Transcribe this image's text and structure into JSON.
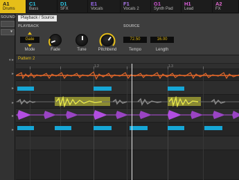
{
  "groups": [
    {
      "id": "A1",
      "name": "Drums",
      "color": "#e6be19",
      "active": true
    },
    {
      "id": "C1",
      "name": "Bass",
      "color": "#2ec7e6",
      "active": false
    },
    {
      "id": "D1",
      "name": "SFX",
      "color": "#2ec7e6",
      "active": false
    },
    {
      "id": "E1",
      "name": "Vocals",
      "color": "#9b6cf0",
      "active": false
    },
    {
      "id": "F1",
      "name": "Vocals 2",
      "color": "#b07cf0",
      "active": false
    },
    {
      "id": "G1",
      "name": "Synth Pad",
      "color": "#d458d8",
      "active": false
    },
    {
      "id": "H1",
      "name": "Lead",
      "color": "#e060e0",
      "active": false
    },
    {
      "id": "A2",
      "name": "FX",
      "color": "#e06ad0",
      "active": false
    }
  ],
  "left": {
    "sound_label": "SOUND",
    "menu_arrow": "▾"
  },
  "panel": {
    "tab_label": "Playback / Source",
    "playback_section": "PLAYBACK",
    "source_section": "SOURCE",
    "mode": {
      "value": "Gate",
      "label": "Mode"
    },
    "fade": {
      "label": "Fade",
      "level": 0.35
    },
    "tune": {
      "label": "Tune",
      "level": 0.5
    },
    "pitchbend": {
      "label": "Pitchbend",
      "level": 0.7
    },
    "tempo": {
      "value": "72.50",
      "label": "Tempo"
    },
    "length": {
      "value": "16.00",
      "label": "Length"
    }
  },
  "pattern": {
    "label": "Pattern 2",
    "menu_arrow": "▾"
  },
  "ruler": {
    "marks": [
      "1.2",
      "1.3"
    ]
  },
  "colors": {
    "accent": "#e6be19",
    "clip": "#16a6d6",
    "waveform_orange": "#e0662a",
    "waveform_purple": "#b24ee0",
    "waveform_yellow": "#e2e24a",
    "selection": "#dede3c"
  }
}
